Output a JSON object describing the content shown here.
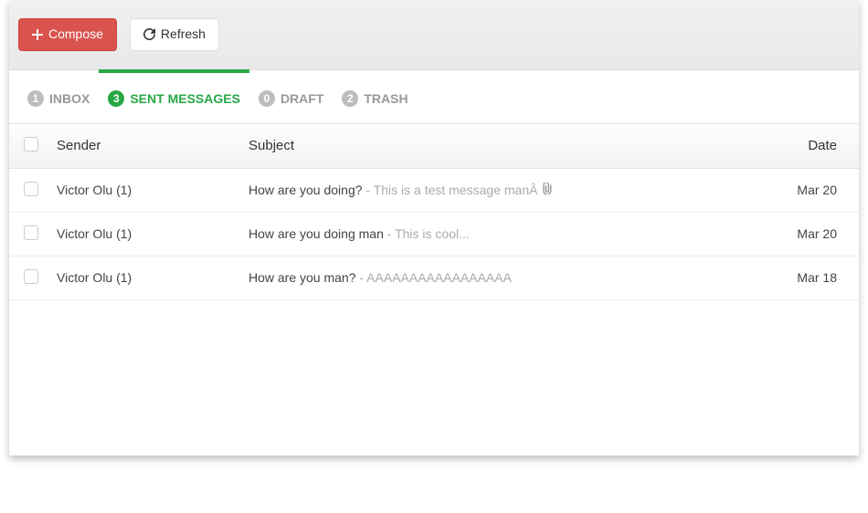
{
  "toolbar": {
    "compose_label": "Compose",
    "refresh_label": "Refresh"
  },
  "tabs": [
    {
      "label": "INBOX",
      "count": "1"
    },
    {
      "label": "SENT MESSAGES",
      "count": "3"
    },
    {
      "label": "DRAFT",
      "count": "0"
    },
    {
      "label": "TRASH",
      "count": "2"
    }
  ],
  "columns": {
    "sender": "Sender",
    "subject": "Subject",
    "date": "Date"
  },
  "rows": [
    {
      "sender": "Victor Olu (1)",
      "subject": "How are you doing?",
      "preview": " - This is a test message manÂ ",
      "attachment": true,
      "date": "Mar 20"
    },
    {
      "sender": "Victor Olu (1)",
      "subject": "How are you doing man",
      "preview": " - This is cool...",
      "attachment": false,
      "date": "Mar 20"
    },
    {
      "sender": "Victor Olu (1)",
      "subject": "How are you man?",
      "preview": " - AAAAAAAAAAAAAAAAA",
      "attachment": false,
      "date": "Mar 18"
    }
  ]
}
